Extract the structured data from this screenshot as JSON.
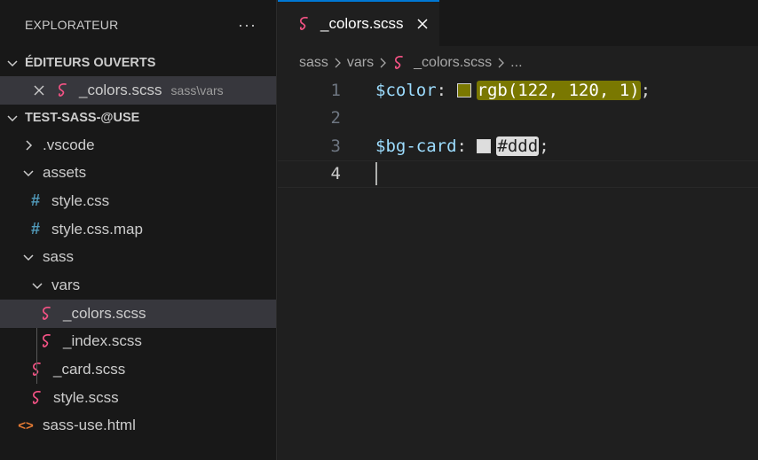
{
  "explorer": {
    "title": "EXPLORATEUR",
    "more": "···",
    "open_editors": {
      "label": "ÉDITEURS OUVERTS",
      "items": [
        {
          "name": "_colors.scss",
          "suffix": "sass\\vars"
        }
      ]
    },
    "project": {
      "label": "TEST-SASS-@USE",
      "tree": [
        {
          "name": ".vscode",
          "type": "folder",
          "expanded": false
        },
        {
          "name": "assets",
          "type": "folder",
          "expanded": true
        },
        {
          "name": "style.css",
          "type": "css"
        },
        {
          "name": "style.css.map",
          "type": "css"
        },
        {
          "name": "sass",
          "type": "folder",
          "expanded": true
        },
        {
          "name": "vars",
          "type": "folder",
          "expanded": true
        },
        {
          "name": "_colors.scss",
          "type": "scss"
        },
        {
          "name": "_index.scss",
          "type": "scss"
        },
        {
          "name": "_card.scss",
          "type": "scss"
        },
        {
          "name": "style.scss",
          "type": "scss"
        },
        {
          "name": "sass-use.html",
          "type": "html"
        }
      ]
    }
  },
  "tab": {
    "label": "_colors.scss"
  },
  "breadcrumb": {
    "items": [
      "sass",
      "vars",
      "_colors.scss",
      "..."
    ]
  },
  "code": {
    "lines": [
      {
        "num": "1",
        "var": "$color",
        "colon": ":",
        "value": "rgb(122, 120, 1)",
        "semi": ";",
        "swatch": "#7a7801"
      },
      {
        "num": "2"
      },
      {
        "num": "3",
        "var": "$bg-card",
        "colon": ":",
        "value": "#ddd",
        "semi": ";",
        "swatch": "#dddddd"
      },
      {
        "num": "4"
      }
    ]
  },
  "colors": {
    "accent": "#0078d4",
    "sass_icon": "#f55385",
    "css_icon": "#519aba",
    "html_icon": "#e37933"
  }
}
